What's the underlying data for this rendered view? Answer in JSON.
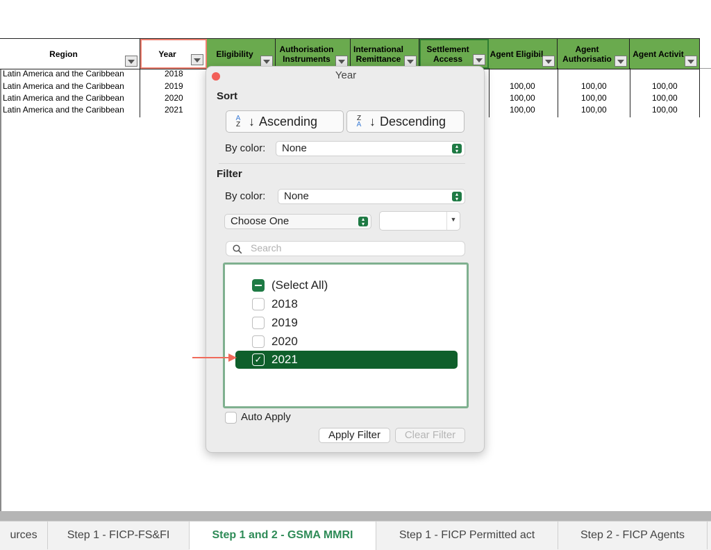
{
  "sheet": {
    "headers": [
      {
        "label": "Region"
      },
      {
        "label": "Year"
      },
      {
        "label": "Eligibility"
      },
      {
        "label": "Authorisation Instruments"
      },
      {
        "label": "International Remittance"
      },
      {
        "label": "Settlement Access"
      },
      {
        "label": "Agent Eligibil"
      },
      {
        "label": "Agent Authorisatio"
      },
      {
        "label": "Agent Activit"
      }
    ],
    "rows": [
      {
        "region": "Latin America and the Caribbean",
        "year": "2018",
        "agent_eligibility": "",
        "agent_authorisation": "",
        "agent_activity": ""
      },
      {
        "region": "Latin America and the Caribbean",
        "year": "2019",
        "agent_eligibility": "100,00",
        "agent_authorisation": "100,00",
        "agent_activity": "100,00"
      },
      {
        "region": "Latin America and the Caribbean",
        "year": "2020",
        "agent_eligibility": "100,00",
        "agent_authorisation": "100,00",
        "agent_activity": "100,00"
      },
      {
        "region": "Latin America and the Caribbean",
        "year": "2021",
        "agent_eligibility": "100,00",
        "agent_authorisation": "100,00",
        "agent_activity": "100,00"
      }
    ]
  },
  "filter_popup": {
    "title": "Year",
    "sort_heading": "Sort",
    "ascending_label": "Ascending",
    "descending_label": "Descending",
    "sort_by_color_label": "By color:",
    "sort_by_color_value": "None",
    "filter_heading": "Filter",
    "filter_by_color_label": "By color:",
    "filter_by_color_value": "None",
    "condition_value": "Choose One",
    "condition_input_value": "",
    "search_placeholder": "Search",
    "select_all_label": "(Select All)",
    "items": [
      {
        "label": "2018",
        "checked": false
      },
      {
        "label": "2019",
        "checked": false
      },
      {
        "label": "2020",
        "checked": false
      },
      {
        "label": "2021",
        "checked": true
      }
    ],
    "auto_apply_label": "Auto Apply",
    "apply_label": "Apply Filter",
    "clear_label": "Clear Filter"
  },
  "sheet_tabs": [
    {
      "label": "urces"
    },
    {
      "label": "Step 1 - FICP-FS&FI"
    },
    {
      "label": "Step 1 and 2 - GSMA MMRI",
      "active": true
    },
    {
      "label": "Step 1 - FICP Permitted act"
    },
    {
      "label": "Step 2 - FICP Agents"
    }
  ],
  "colors": {
    "header_green": "#6aaa4e",
    "accent_green": "#1e7a44",
    "annotation_red": "#f06a5a"
  }
}
